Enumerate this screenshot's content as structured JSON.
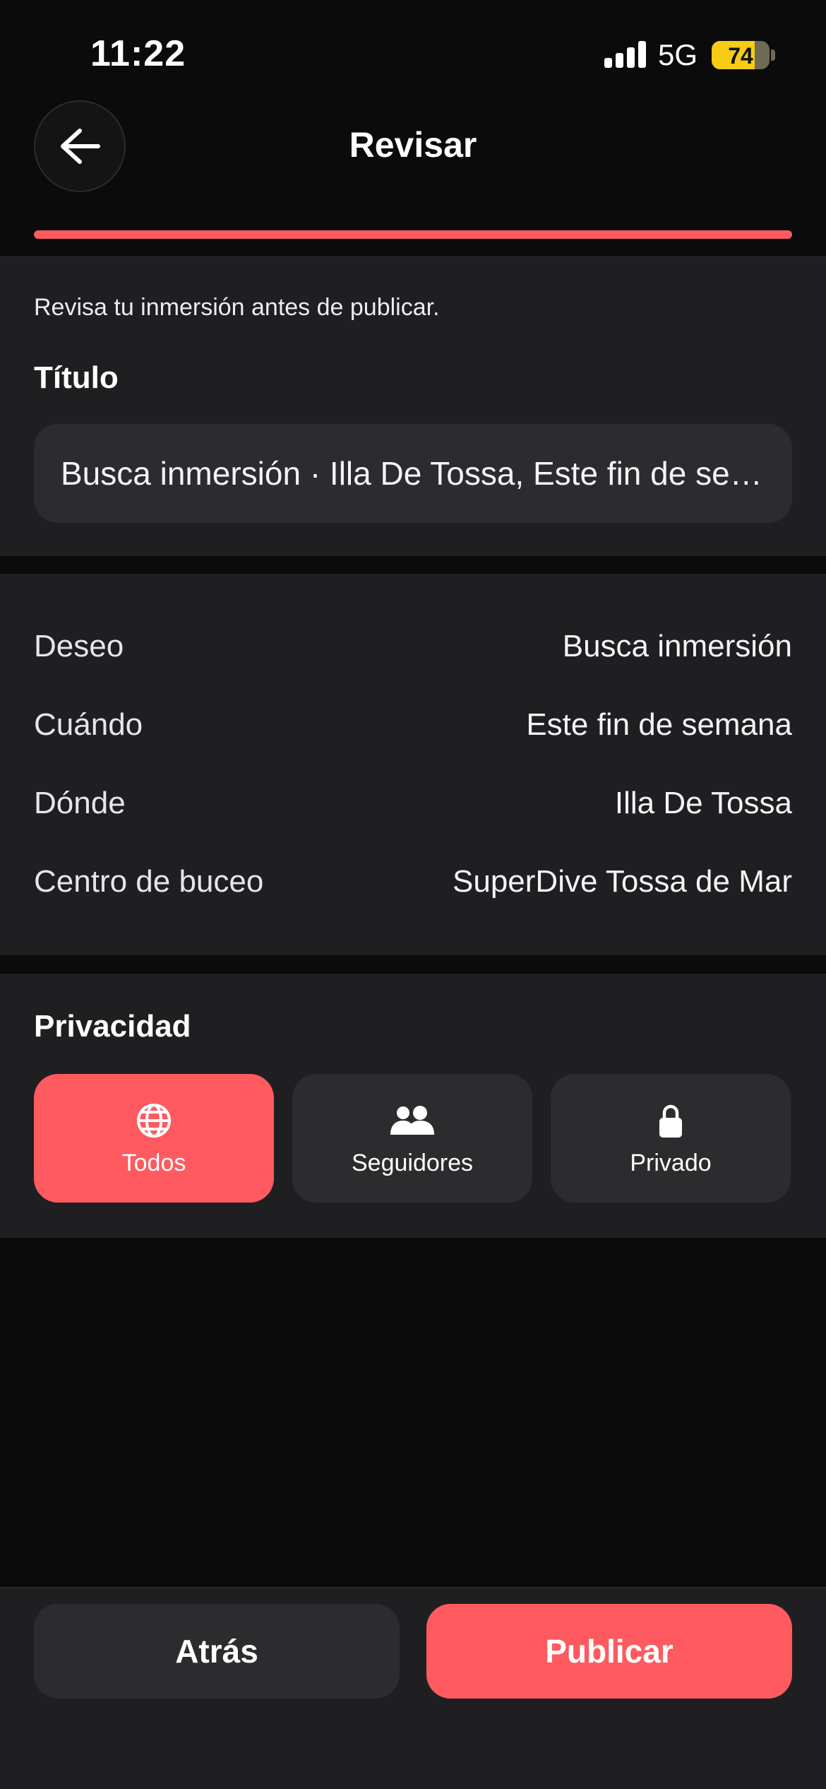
{
  "status_bar": {
    "time": "11:22",
    "network": "5G",
    "battery_level": "74",
    "battery_color": "#f7cc15"
  },
  "header": {
    "title": "Revisar",
    "back_icon": "arrow-left-icon",
    "progress": 1.0,
    "accent_color": "#fe5a60"
  },
  "intro": {
    "text": "Revisa tu inmersión antes de publicar."
  },
  "title_section": {
    "label": "Título",
    "value": "Busca inmersión · Illa De Tossa, Este fin de semana"
  },
  "details": [
    {
      "key": "Deseo",
      "value": "Busca inmersión"
    },
    {
      "key": "Cuándo",
      "value": "Este fin de semana"
    },
    {
      "key": "Dónde",
      "value": "Illa De Tossa"
    },
    {
      "key": "Centro de buceo",
      "value": "SuperDive Tossa de Mar"
    }
  ],
  "privacy": {
    "label": "Privacidad",
    "selected": "Todos",
    "options": [
      {
        "label": "Todos",
        "icon": "globe-icon"
      },
      {
        "label": "Seguidores",
        "icon": "users-icon"
      },
      {
        "label": "Privado",
        "icon": "lock-icon"
      }
    ]
  },
  "actions": {
    "back_label": "Atrás",
    "publish_label": "Publicar"
  }
}
